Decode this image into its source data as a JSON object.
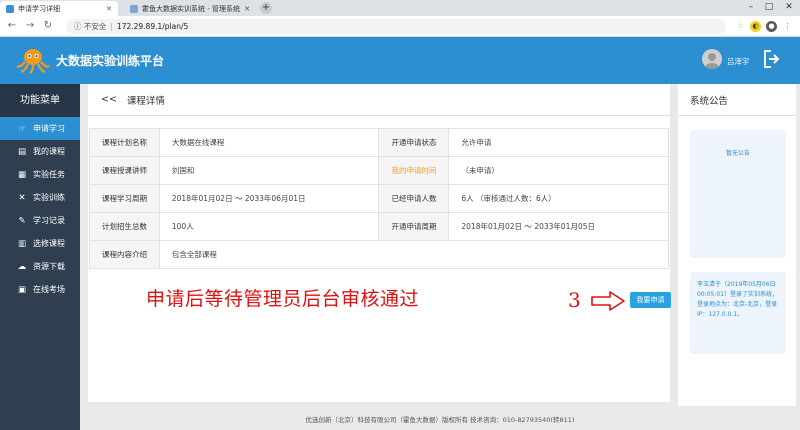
{
  "browser": {
    "tabs": [
      {
        "title": "申请学习详细",
        "active": true
      },
      {
        "title": "霍鱼大数据实训系统 - 管理系统",
        "active": false
      }
    ],
    "security_label": "不安全",
    "url": "172.29.89.1/plan/5"
  },
  "header": {
    "app_title": "大数据实验训练平台",
    "username": "吕泽宇",
    "brand_color": "#2b8fd1"
  },
  "sidebar": {
    "title": "功能菜单",
    "items": [
      {
        "label": "申请学习",
        "icon": "hand-pointer-icon",
        "active": true
      },
      {
        "label": "我的课程",
        "icon": "book-icon",
        "active": false
      },
      {
        "label": "实验任务",
        "icon": "calendar-icon",
        "active": false
      },
      {
        "label": "实验训练",
        "icon": "wrench-icon",
        "active": false
      },
      {
        "label": "学习记录",
        "icon": "edit-icon",
        "active": false
      },
      {
        "label": "选修课程",
        "icon": "library-icon",
        "active": false
      },
      {
        "label": "资源下载",
        "icon": "cloud-download-icon",
        "active": false
      },
      {
        "label": "在线考场",
        "icon": "exam-icon",
        "active": false
      }
    ]
  },
  "main": {
    "back_label": "<<",
    "title": "课程详情",
    "table": {
      "rows": [
        {
          "l1": "课程计划名称",
          "v1": "大数据在线课程",
          "l2": "开通申请状态",
          "v2": "允许申请"
        },
        {
          "l1": "课程授课讲师",
          "v1": "刘国和",
          "l2": "我的申请时间",
          "v2": "（未申请）"
        },
        {
          "l1": "课程学习周期",
          "v1": "2018年01月02日 ～ 2033年06月01日",
          "l2": "已经申请人数",
          "v2": "6人 （审核通过人数：6人）"
        },
        {
          "l1": "计划招生总数",
          "v1": "100人",
          "l2": "开通申请周期",
          "v2": "2018年01月02日 ～ 2033年01月05日"
        },
        {
          "l1": "课程内容介绍",
          "v1": "包含全部课程"
        }
      ]
    },
    "annotation": "申请后等待管理员后台审核通过",
    "step_number": "3",
    "apply_button": "我要申请"
  },
  "notice": {
    "title": "系统公告",
    "empty_text": "暂无公告",
    "login_info": "李玉清于（2019年05月06日00:05:01）登录了实训系统，登录地点为：北京-北京，登录IP：127.0.0.1。"
  },
  "footer": {
    "text": "优选创新（北京）科技有限公司（霍鱼大数据）版权所有  技术咨询：010-82793540(转811)"
  }
}
